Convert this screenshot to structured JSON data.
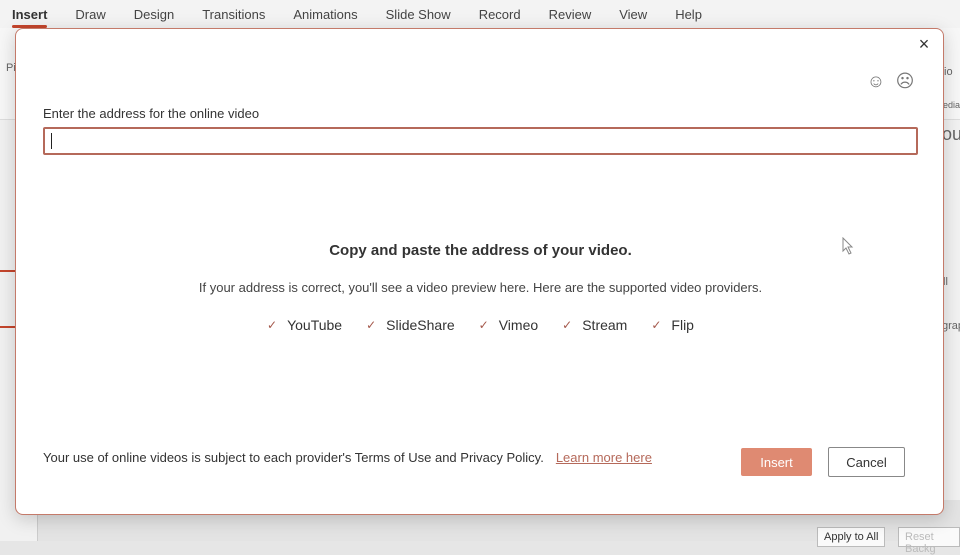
{
  "ribbon": {
    "tabs": [
      {
        "label": "Insert",
        "active": true
      },
      {
        "label": "Draw"
      },
      {
        "label": "Design"
      },
      {
        "label": "Transitions"
      },
      {
        "label": "Animations"
      },
      {
        "label": "Slide Show"
      },
      {
        "label": "Record"
      },
      {
        "label": "Review"
      },
      {
        "label": "View"
      },
      {
        "label": "Help"
      }
    ],
    "fragments": {
      "left": "Pi",
      "right_top": "io",
      "right_media": "edia",
      "right_text": "ou",
      "right_text2": "ll",
      "right_text3": "grap"
    }
  },
  "background_buttons": {
    "apply_all": "Apply to All",
    "reset": "Reset Backg"
  },
  "dialog": {
    "close_icon": "×",
    "smile_icon": "☺",
    "frown_icon": "☹",
    "address_label": "Enter the address for the online video",
    "address_value": "",
    "hint_title": "Copy and paste the address of your video.",
    "hint_text": "If your address is correct, you'll see a video preview here. Here are the supported video providers.",
    "check_icon": "✓",
    "providers": [
      "YouTube",
      "SlideShare",
      "Vimeo",
      "Stream",
      "Flip"
    ],
    "footer_text": "Your use of online videos is subject to each provider's Terms of Use and Privacy Policy.",
    "learn_more": "Learn more here",
    "insert_label": "Insert",
    "cancel_label": "Cancel"
  }
}
